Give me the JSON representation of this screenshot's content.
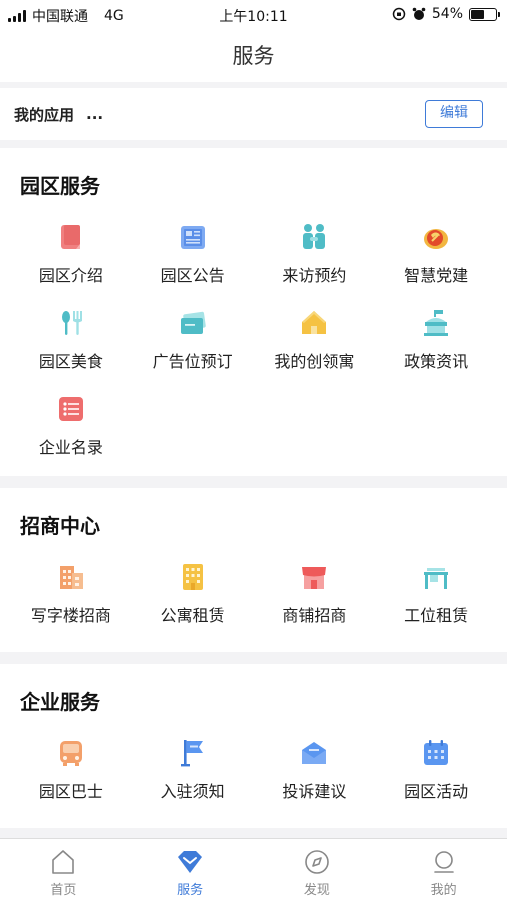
{
  "status_bar": {
    "carrier": "中国联通",
    "network": "4G",
    "time": "上午10:11",
    "battery": "54%"
  },
  "nav": {
    "title": "服务"
  },
  "my_apps": {
    "label": "我的应用",
    "more": "...",
    "edit": "编辑"
  },
  "sections": {
    "park": {
      "title": "园区服务",
      "items": [
        "园区介绍",
        "园区公告",
        "来访预约",
        "智慧党建",
        "园区美食",
        "广告位预订",
        "我的创领寓",
        "政策资讯",
        "企业名录"
      ]
    },
    "invest": {
      "title": "招商中心",
      "items": [
        "写字楼招商",
        "公寓租赁",
        "商铺招商",
        "工位租赁"
      ]
    },
    "enterprise": {
      "title": "企业服务",
      "items": [
        "园区巴士",
        "入驻须知",
        "投诉建议",
        "园区活动"
      ]
    }
  },
  "tabbar": {
    "items": [
      "首页",
      "服务",
      "发现",
      "我的"
    ],
    "active": "服务"
  },
  "colors": {
    "accent": "#3f7bd8",
    "red": "#ef6f6f",
    "blue": "#5a96f0",
    "teal": "#4fc3c8",
    "yellow": "#f5c243",
    "orange": "#f39a5c"
  }
}
